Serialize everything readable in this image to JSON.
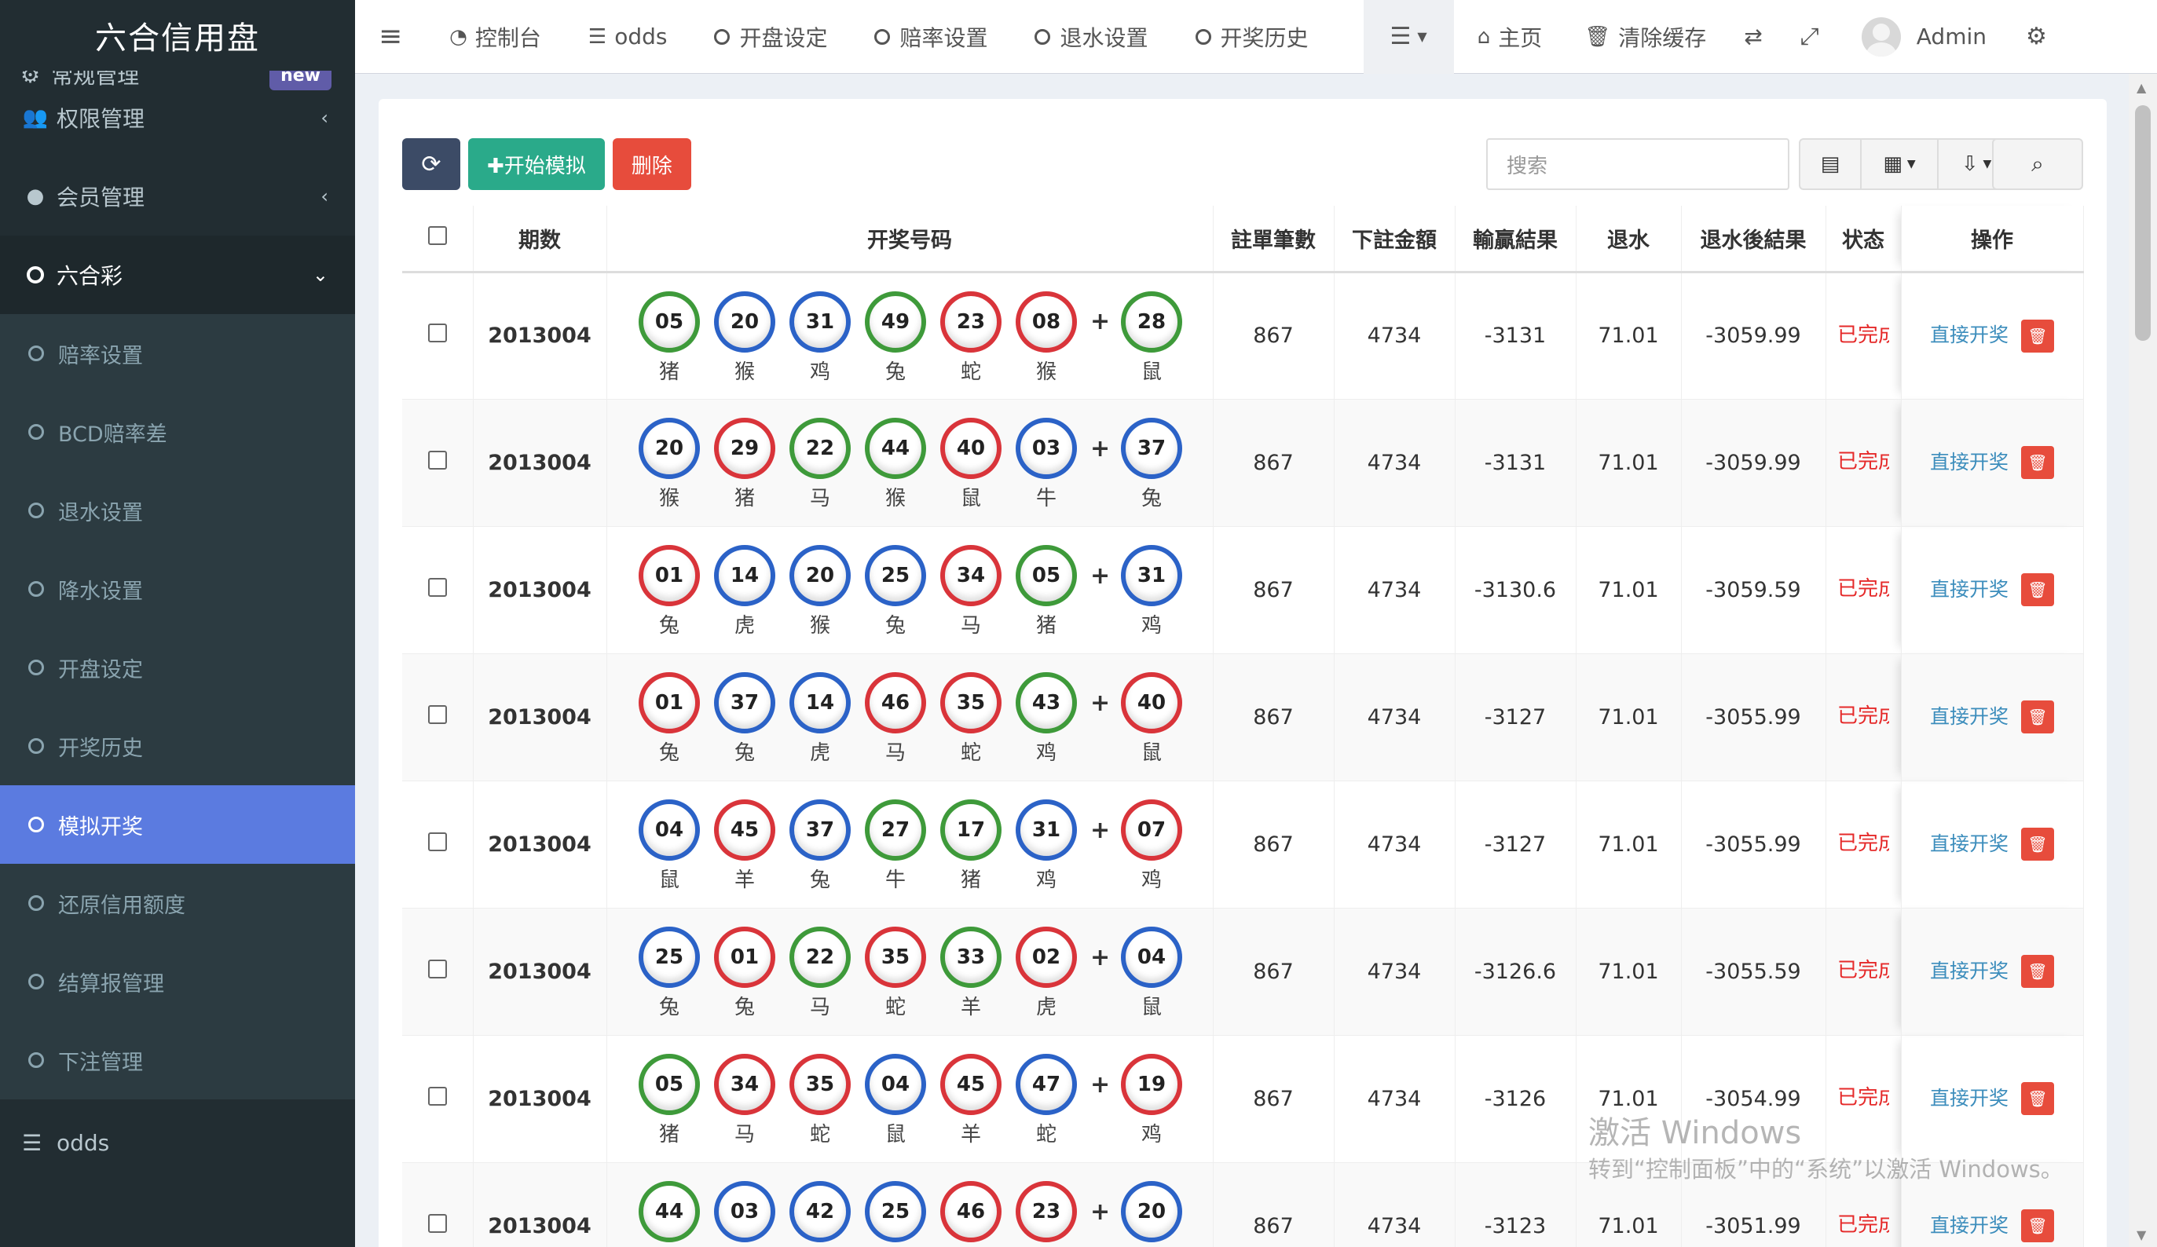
{
  "app": {
    "logo": "六合信用盘"
  },
  "sidebar": {
    "partial_item": {
      "label": "常规管理",
      "badge": "new"
    },
    "items": [
      {
        "label": "权限管理",
        "icon": "users-icon",
        "arrow": "‹"
      },
      {
        "label": "会员管理",
        "icon": "user-icon",
        "arrow": "‹"
      },
      {
        "label": "六合彩",
        "icon": "circle-icon",
        "arrow": "⌄"
      }
    ],
    "subitems": [
      {
        "label": "赔率设置"
      },
      {
        "label": "BCD赔率差"
      },
      {
        "label": "退水设置"
      },
      {
        "label": "降水设置"
      },
      {
        "label": "开盘设定"
      },
      {
        "label": "开奖历史"
      },
      {
        "label": "模拟开奖",
        "active": true
      },
      {
        "label": "还原信用额度"
      },
      {
        "label": "结算报管理"
      },
      {
        "label": "下注管理"
      }
    ],
    "bottom_item": {
      "label": "odds",
      "icon": "list-icon"
    }
  },
  "topnav": {
    "items": [
      {
        "label": "控制台",
        "icon": "dashboard-icon"
      },
      {
        "label": "odds",
        "icon": "list-icon"
      },
      {
        "label": "开盘设定",
        "icon": "circle-icon"
      },
      {
        "label": "赔率设置",
        "icon": "circle-icon"
      },
      {
        "label": "退水设置",
        "icon": "circle-icon"
      },
      {
        "label": "开奖历史",
        "icon": "circle-icon"
      }
    ],
    "home": "主页",
    "clear_cache": "清除缓存",
    "user": "Admin"
  },
  "toolbar": {
    "simulate_label": "✚开始模拟",
    "delete_label": "删除",
    "search_placeholder": "搜索"
  },
  "table": {
    "headers": [
      "期数",
      "开奖号码",
      "註單筆數",
      "下註金額",
      "輸贏結果",
      "退水",
      "退水後結果",
      "状态",
      "操作"
    ],
    "operation_label": "直接开奖",
    "status_label": "已完成",
    "rows": [
      {
        "period": "2013004",
        "balls": [
          {
            "n": "05",
            "z": "猪",
            "c": "green"
          },
          {
            "n": "20",
            "z": "猴",
            "c": "blue"
          },
          {
            "n": "31",
            "z": "鸡",
            "c": "blue"
          },
          {
            "n": "49",
            "z": "兔",
            "c": "green"
          },
          {
            "n": "23",
            "z": "蛇",
            "c": "red"
          },
          {
            "n": "08",
            "z": "猴",
            "c": "red"
          },
          {
            "n": "28",
            "z": "鼠",
            "c": "green"
          }
        ],
        "count": "867",
        "amount": "4734",
        "result": "-3131",
        "rebate": "71.01",
        "after": "-3059.99"
      },
      {
        "period": "2013004",
        "balls": [
          {
            "n": "20",
            "z": "猴",
            "c": "blue"
          },
          {
            "n": "29",
            "z": "猪",
            "c": "red"
          },
          {
            "n": "22",
            "z": "马",
            "c": "green"
          },
          {
            "n": "44",
            "z": "猴",
            "c": "green"
          },
          {
            "n": "40",
            "z": "鼠",
            "c": "red"
          },
          {
            "n": "03",
            "z": "牛",
            "c": "blue"
          },
          {
            "n": "37",
            "z": "兔",
            "c": "blue"
          }
        ],
        "count": "867",
        "amount": "4734",
        "result": "-3131",
        "rebate": "71.01",
        "after": "-3059.99"
      },
      {
        "period": "2013004",
        "balls": [
          {
            "n": "01",
            "z": "兔",
            "c": "red"
          },
          {
            "n": "14",
            "z": "虎",
            "c": "blue"
          },
          {
            "n": "20",
            "z": "猴",
            "c": "blue"
          },
          {
            "n": "25",
            "z": "兔",
            "c": "blue"
          },
          {
            "n": "34",
            "z": "马",
            "c": "red"
          },
          {
            "n": "05",
            "z": "猪",
            "c": "green"
          },
          {
            "n": "31",
            "z": "鸡",
            "c": "blue"
          }
        ],
        "count": "867",
        "amount": "4734",
        "result": "-3130.6",
        "rebate": "71.01",
        "after": "-3059.59"
      },
      {
        "period": "2013004",
        "balls": [
          {
            "n": "01",
            "z": "兔",
            "c": "red"
          },
          {
            "n": "37",
            "z": "兔",
            "c": "blue"
          },
          {
            "n": "14",
            "z": "虎",
            "c": "blue"
          },
          {
            "n": "46",
            "z": "马",
            "c": "red"
          },
          {
            "n": "35",
            "z": "蛇",
            "c": "red"
          },
          {
            "n": "43",
            "z": "鸡",
            "c": "green"
          },
          {
            "n": "40",
            "z": "鼠",
            "c": "red"
          }
        ],
        "count": "867",
        "amount": "4734",
        "result": "-3127",
        "rebate": "71.01",
        "after": "-3055.99"
      },
      {
        "period": "2013004",
        "balls": [
          {
            "n": "04",
            "z": "鼠",
            "c": "blue"
          },
          {
            "n": "45",
            "z": "羊",
            "c": "red"
          },
          {
            "n": "37",
            "z": "兔",
            "c": "blue"
          },
          {
            "n": "27",
            "z": "牛",
            "c": "green"
          },
          {
            "n": "17",
            "z": "猪",
            "c": "green"
          },
          {
            "n": "31",
            "z": "鸡",
            "c": "blue"
          },
          {
            "n": "07",
            "z": "鸡",
            "c": "red"
          }
        ],
        "count": "867",
        "amount": "4734",
        "result": "-3127",
        "rebate": "71.01",
        "after": "-3055.99"
      },
      {
        "period": "2013004",
        "balls": [
          {
            "n": "25",
            "z": "兔",
            "c": "blue"
          },
          {
            "n": "01",
            "z": "兔",
            "c": "red"
          },
          {
            "n": "22",
            "z": "马",
            "c": "green"
          },
          {
            "n": "35",
            "z": "蛇",
            "c": "red"
          },
          {
            "n": "33",
            "z": "羊",
            "c": "green"
          },
          {
            "n": "02",
            "z": "虎",
            "c": "red"
          },
          {
            "n": "04",
            "z": "鼠",
            "c": "blue"
          }
        ],
        "count": "867",
        "amount": "4734",
        "result": "-3126.6",
        "rebate": "71.01",
        "after": "-3055.59"
      },
      {
        "period": "2013004",
        "balls": [
          {
            "n": "05",
            "z": "猪",
            "c": "green"
          },
          {
            "n": "34",
            "z": "马",
            "c": "red"
          },
          {
            "n": "35",
            "z": "蛇",
            "c": "red"
          },
          {
            "n": "04",
            "z": "鼠",
            "c": "blue"
          },
          {
            "n": "45",
            "z": "羊",
            "c": "red"
          },
          {
            "n": "47",
            "z": "蛇",
            "c": "blue"
          },
          {
            "n": "19",
            "z": "鸡",
            "c": "red"
          }
        ],
        "count": "867",
        "amount": "4734",
        "result": "-3126",
        "rebate": "71.01",
        "after": "-3054.99"
      },
      {
        "period": "2013004",
        "balls": [
          {
            "n": "44",
            "z": "",
            "c": "green"
          },
          {
            "n": "03",
            "z": "",
            "c": "blue"
          },
          {
            "n": "42",
            "z": "",
            "c": "blue"
          },
          {
            "n": "25",
            "z": "",
            "c": "blue"
          },
          {
            "n": "46",
            "z": "",
            "c": "red"
          },
          {
            "n": "23",
            "z": "",
            "c": "red"
          },
          {
            "n": "20",
            "z": "",
            "c": "blue"
          }
        ],
        "count": "867",
        "amount": "4734",
        "result": "-3123",
        "rebate": "71.01",
        "after": "-3051.99"
      }
    ]
  },
  "watermark": {
    "line1": "激活 Windows",
    "line2": "转到“控制面板”中的“系统”以激活 Windows。"
  }
}
